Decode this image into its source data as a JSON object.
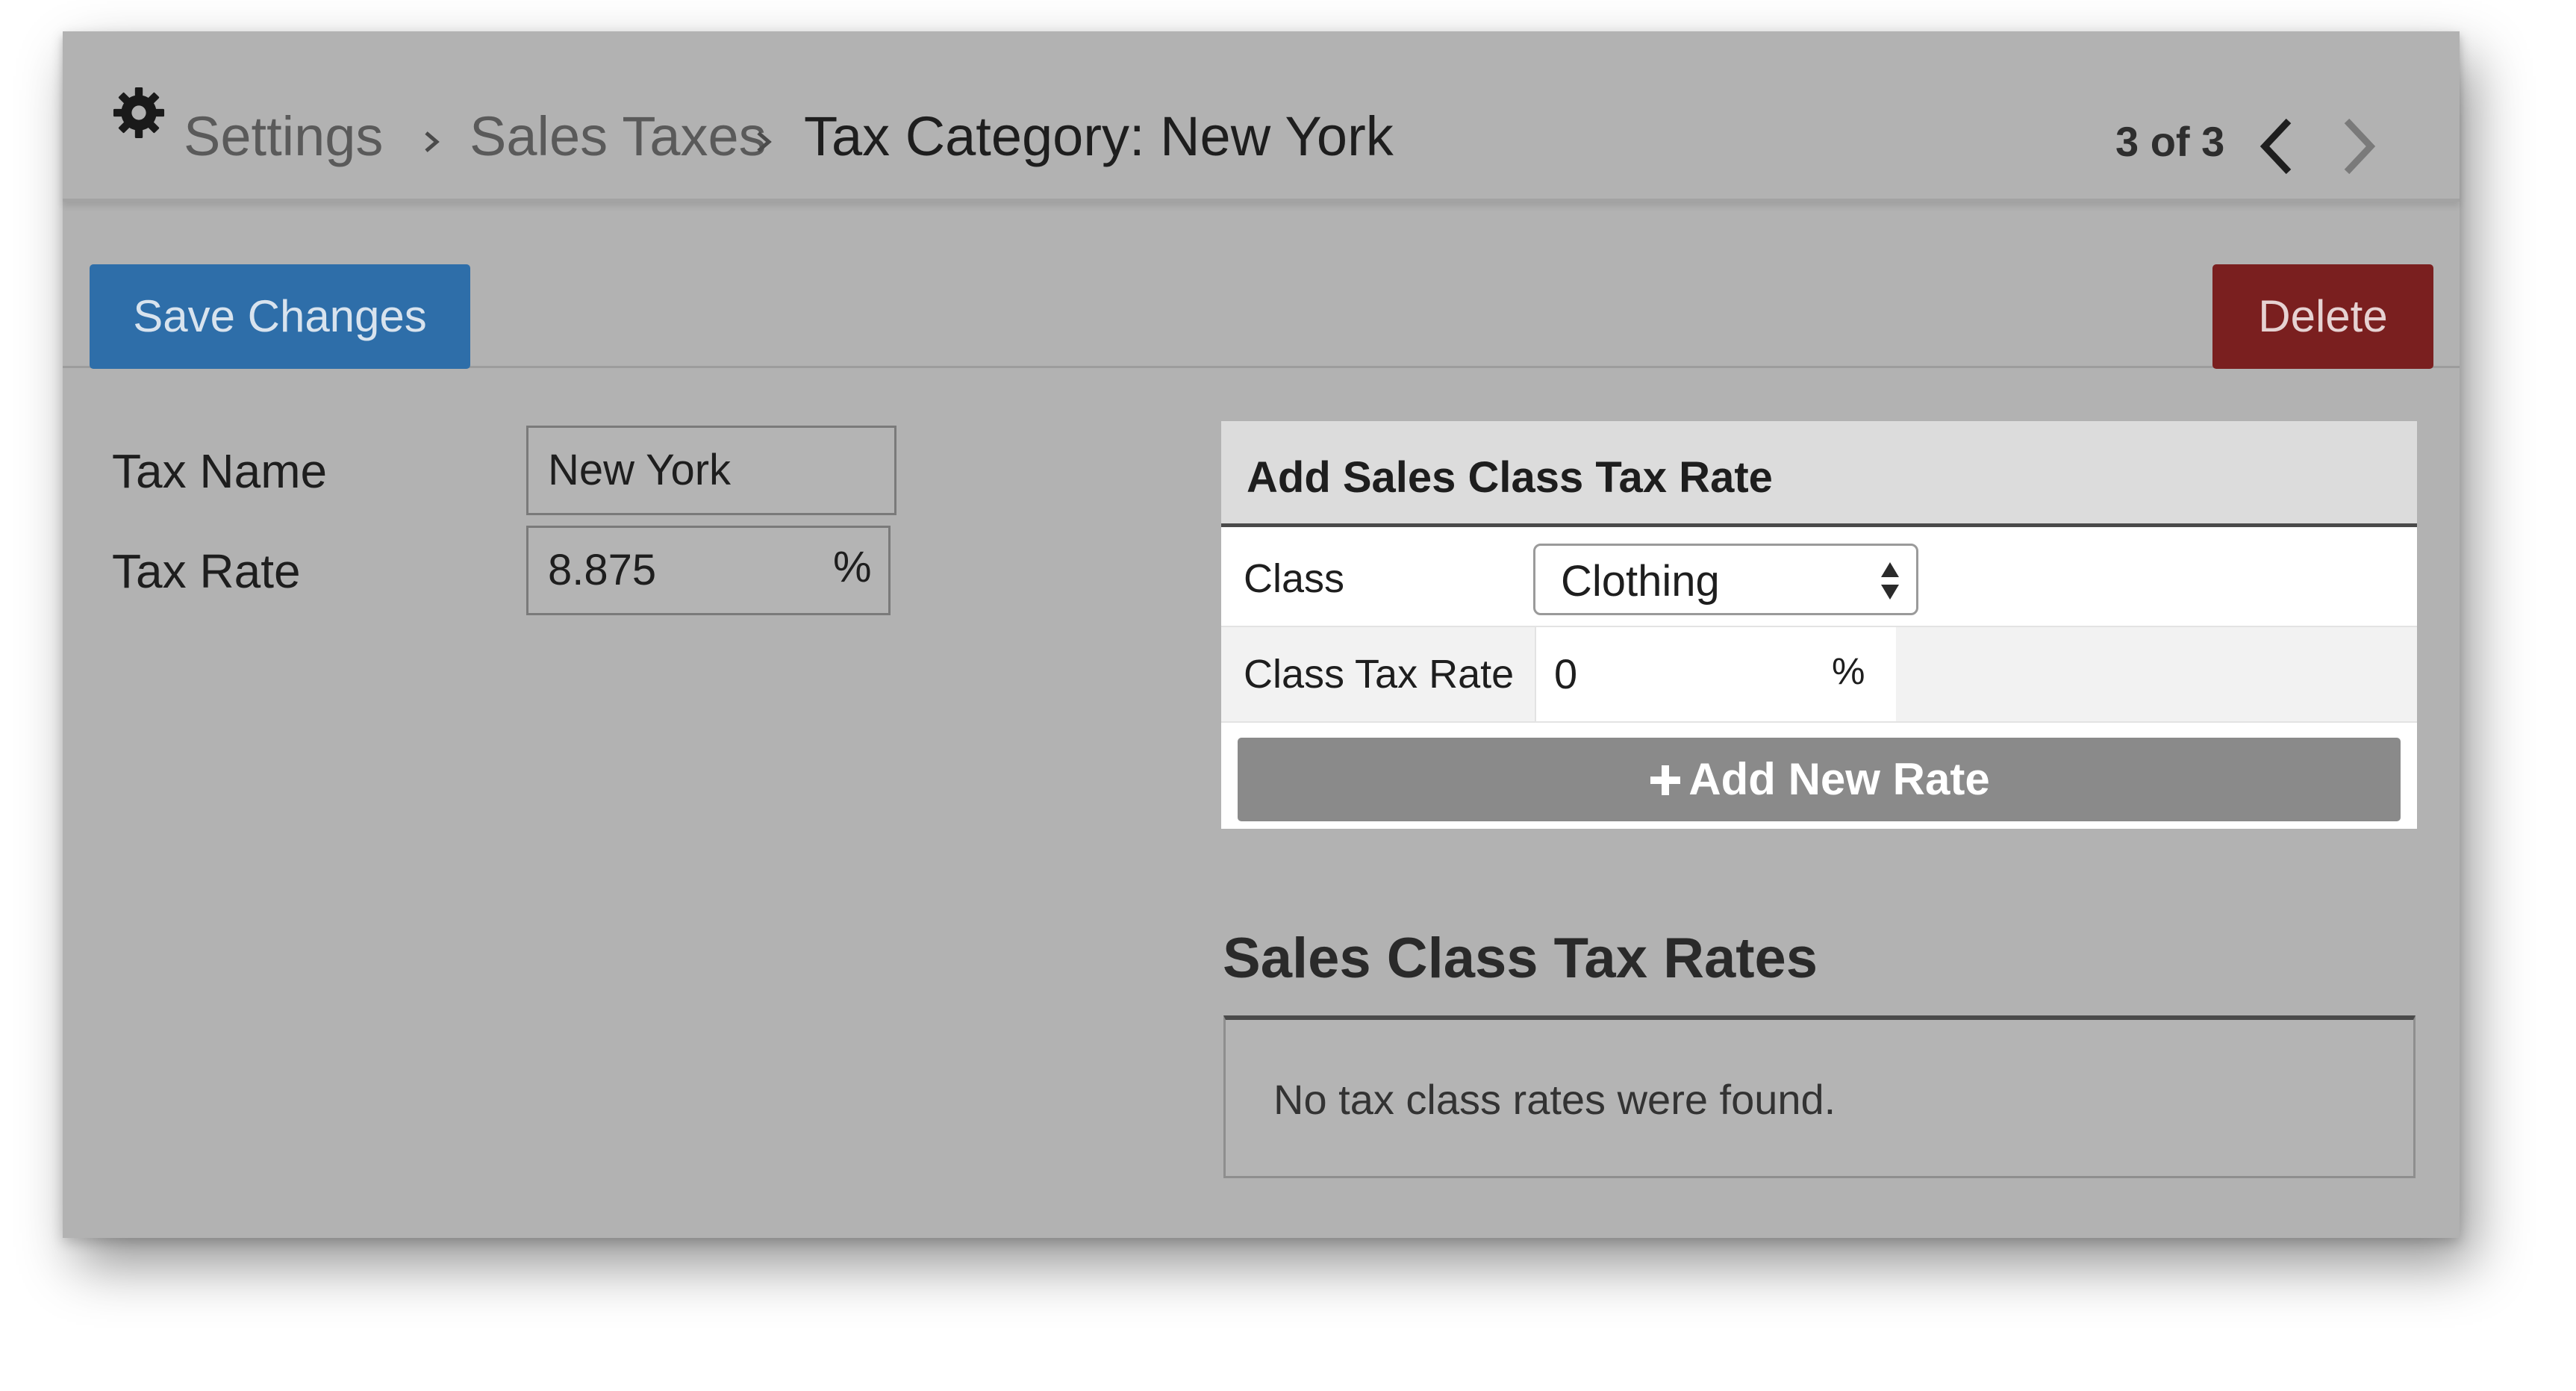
{
  "header": {
    "icon": "gear-icon",
    "breadcrumb": [
      {
        "label": "Settings"
      },
      {
        "label": "Sales Taxes"
      },
      {
        "label": "Tax Category: New York"
      }
    ],
    "pager": "3 of 3"
  },
  "toolbar": {
    "save_label": "Save Changes",
    "delete_label": "Delete"
  },
  "form": {
    "tax_name_label": "Tax Name",
    "tax_name_value": "New York",
    "tax_rate_label": "Tax Rate",
    "tax_rate_value": "8.875",
    "tax_rate_unit": "%"
  },
  "add_panel": {
    "title": "Add Sales Class Tax Rate",
    "class_label": "Class",
    "class_selected": "Clothing",
    "class_tax_rate_label": "Class Tax Rate",
    "class_tax_rate_value": "0",
    "class_tax_rate_unit": "%",
    "add_button_label": "Add New Rate"
  },
  "rates_section": {
    "title": "Sales Class Tax Rates",
    "empty_message": "No tax class rates were found."
  },
  "colors": {
    "background": "#b2b2b2",
    "save_button": "#2e6ea9",
    "delete_button": "#7a1f1f",
    "add_button": "#8a8a8a"
  }
}
